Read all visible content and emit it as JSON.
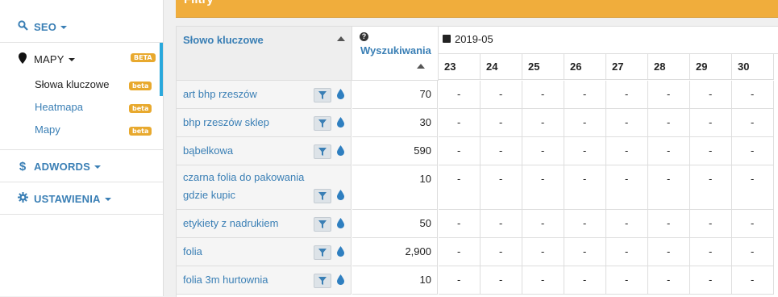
{
  "sidebar": {
    "seo_label": "SEO",
    "mapy_label": "MAPY",
    "mapy_badge": "BETA",
    "sub_items": [
      {
        "label": "Słowa kluczowe",
        "badge": "beta"
      },
      {
        "label": "Heatmapa",
        "badge": "beta"
      },
      {
        "label": "Mapy",
        "badge": "beta"
      }
    ],
    "adwords_label": "ADWORDS",
    "ustawienia_label": "USTAWIENIA"
  },
  "topbar": {
    "title": "Filtry"
  },
  "table": {
    "keyword_header": "Słowo kluczowe",
    "searches_header": "Wyszukiwania",
    "month": "2019-05",
    "days": [
      "23",
      "24",
      "25",
      "26",
      "27",
      "28",
      "29",
      "30"
    ],
    "rows": [
      {
        "keyword": "art bhp rzeszów",
        "searches": "70",
        "cells": [
          "-",
          "-",
          "-",
          "-",
          "-",
          "-",
          "-",
          "-"
        ]
      },
      {
        "keyword": "bhp rzeszów sklep",
        "searches": "30",
        "cells": [
          "-",
          "-",
          "-",
          "-",
          "-",
          "-",
          "-",
          "-"
        ]
      },
      {
        "keyword": "bąbelkowa",
        "searches": "590",
        "cells": [
          "-",
          "-",
          "-",
          "-",
          "-",
          "-",
          "-",
          "-"
        ]
      },
      {
        "keyword": "czarna folia do pakowania gdzie kupic",
        "searches": "10",
        "cells": [
          "-",
          "-",
          "-",
          "-",
          "-",
          "-",
          "-",
          "-"
        ]
      },
      {
        "keyword": "etykiety z nadrukiem",
        "searches": "50",
        "cells": [
          "-",
          "-",
          "-",
          "-",
          "-",
          "-",
          "-",
          "-"
        ]
      },
      {
        "keyword": "folia",
        "searches": "2,900",
        "cells": [
          "-",
          "-",
          "-",
          "-",
          "-",
          "-",
          "-",
          "-"
        ]
      },
      {
        "keyword": "folia 3m hurtownia",
        "searches": "10",
        "cells": [
          "-",
          "-",
          "-",
          "-",
          "-",
          "-",
          "-",
          "-"
        ]
      }
    ]
  },
  "colors": {
    "accent": "#3a7fb5",
    "topbar": "#f0ad3c",
    "badge": "#e8a92e",
    "active_bar": "#29a8dc"
  }
}
